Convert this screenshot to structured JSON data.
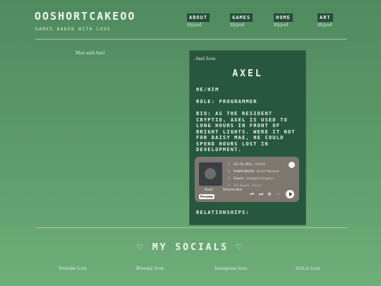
{
  "header": {
    "title": "OOSHORTCAKEOO",
    "tagline": "GAMES BAKED WITH LOVE"
  },
  "nav": [
    {
      "label": "ABOUT",
      "img_alt": "lilypad"
    },
    {
      "label": "GAMES",
      "img_alt": "lilypad"
    },
    {
      "label": "HOME",
      "img_alt": "lilypad"
    },
    {
      "label": "ART",
      "img_alt": "lilypad"
    }
  ],
  "left_image_alt": "Max and Axel",
  "profile": {
    "icon_alt": "Axel Icon",
    "name": "AXEL",
    "pronouns": "HE/HIM",
    "role": "ROLE: PROGRAMMER",
    "bio": "BIO: AS THE RESIDENT CRYPTID, AXEL IS USED TO LONG HOURS IN FRONT OF BRIGHT LIGHTS. WERE IT NOT FOR DAISY MAE, HE COULD SPEND HOURS LOST IN DEVELOPMENT.",
    "relationships": "RELATIONSHIPS:"
  },
  "playlist": {
    "owner": "Axel",
    "name": "Shortcake",
    "preview_label": "Preview",
    "tracks": [
      {
        "num": "1",
        "title": "GO TO HELL",
        "artist": "KAYAD"
      },
      {
        "num": "2",
        "title": "RUNRUNRUN",
        "artist": "Dutch Melrose"
      },
      {
        "num": "3",
        "title": "Sharks",
        "artist": "Imagine Dragons"
      },
      {
        "num": "4",
        "title": "Too Sweet",
        "artist": "Hozier"
      }
    ]
  },
  "socials": {
    "title": "♡ MY SOCIALS ♡",
    "items": [
      {
        "alt": "Youtube Icon"
      },
      {
        "alt": "Bluesky Icon"
      },
      {
        "alt": "Instagram Icon"
      },
      {
        "alt": "Itch.io Icon"
      }
    ]
  }
}
